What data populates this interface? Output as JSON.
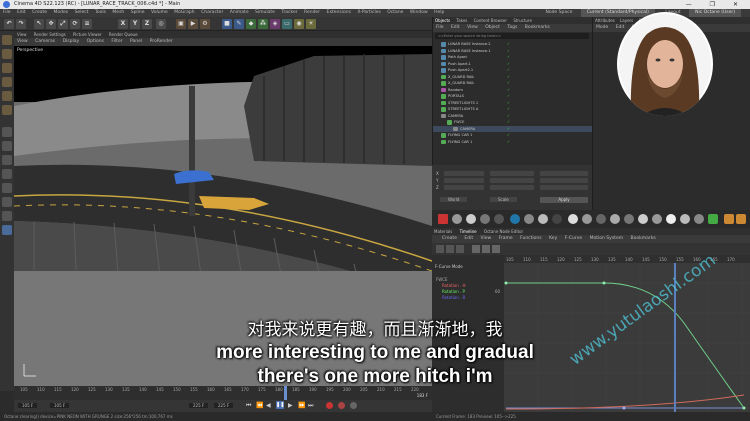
{
  "titlebar": {
    "title": "Cinema 4D S22.123 (RC) - [LUNAR_RACE_TRACK_006.c4d *] - Main",
    "controls": "— ❐ ✕"
  },
  "menubar": {
    "items": [
      "File",
      "Edit",
      "Create",
      "Modes",
      "Select",
      "Tools",
      "Mesh",
      "Spline",
      "Volume",
      "MoGraph",
      "Character",
      "Animate",
      "Simulate",
      "Tracker",
      "Render",
      "Extensions",
      "X-Particles",
      "Octane",
      "Window",
      "Help"
    ],
    "node_space_label": "Node Space",
    "node_space_value": "Current (Standard/Physical)",
    "layout_label": "Layout",
    "layout_value": "Nic Octane (User)"
  },
  "toolbar": {
    "axis_labels": [
      "X",
      "Y",
      "Z"
    ]
  },
  "viewport": {
    "tabs": [
      "View",
      "Render Settings",
      "Picture Viewer",
      "Render Queue"
    ],
    "menu": [
      "View",
      "Cameras",
      "Display",
      "Options",
      "Filter",
      "Panel",
      "ProRender"
    ],
    "label": "Perspective"
  },
  "timeline": {
    "ticks": [
      "105",
      "110",
      "115",
      "120",
      "125",
      "130",
      "135",
      "140",
      "145",
      "150",
      "155",
      "160",
      "165",
      "170",
      "175",
      "180",
      "185",
      "190",
      "195",
      "200",
      "205",
      "210",
      "215",
      "220"
    ],
    "start_field": "105 F",
    "end_field": "225 F",
    "current_frame": "183 F",
    "start_frame": "105 F",
    "end_frame": "225 F"
  },
  "statusbar": {
    "text": "Octane:clearing() device=PINK NEON WITH GRUNGE 2  size:256*256  tm:100,767 ms"
  },
  "objects": {
    "tabs": [
      "Objects",
      "Takes",
      "Content Browser",
      "Structure"
    ],
    "menu": [
      "File",
      "Edit",
      "View",
      "Object",
      "Tags",
      "Bookmarks"
    ],
    "search_placeholder": "<<Enter your search string here>>",
    "rows": [
      "LUNAR BASE Instance.2",
      "LUNAR BASE Instance.1",
      "Path Apart",
      "Push Apart.1",
      "Push Apart2.1",
      "X_GUARD RAIL",
      "X_GUARD RAIL",
      "Random",
      "PORTALS",
      "STREETLIGHTS 1",
      "STREETLIGHTS A",
      "CAMERA",
      "FWCE",
      "CAMERA",
      "FLYING CAR 1",
      "FLYING CAR 1"
    ]
  },
  "attributes": {
    "axes": [
      "X",
      "Y",
      "Z"
    ],
    "apply_label": "Apply",
    "world_label": "World",
    "scale_label": "Scale"
  },
  "right_panel": {
    "tabs": [
      "Attributes",
      "Layers",
      "Octane Live"
    ],
    "menu": [
      "Mode",
      "Edit",
      "User Data"
    ]
  },
  "lower": {
    "tabs": [
      "Materials",
      "Timeline",
      "Octane Node Editor"
    ],
    "menu": [
      "Create",
      "Edit",
      "View",
      "Frame",
      "Functions",
      "Key",
      "F-Curve",
      "Motion System",
      "Bookmarks"
    ],
    "fcurve_mode": "F-Curve Mode",
    "tracks": [
      "Rotation . H",
      "Rotation . P",
      "Rotation . B"
    ],
    "track_root": "FWCE",
    "graph_ticks": [
      "105",
      "110",
      "115",
      "120",
      "125",
      "130",
      "135",
      "140",
      "145",
      "150",
      "155",
      "160",
      "165",
      "170",
      "175"
    ],
    "graph_value": "60"
  },
  "subtitles": {
    "chinese": "对我来说更有趣，而且渐渐地，我",
    "line1": "more interesting to me and gradual",
    "line2": "there's one more hitch i'm"
  },
  "watermark": "www.yutulaoshi.com",
  "status_right": "Current Frame: 183   Preview: 105-->225"
}
